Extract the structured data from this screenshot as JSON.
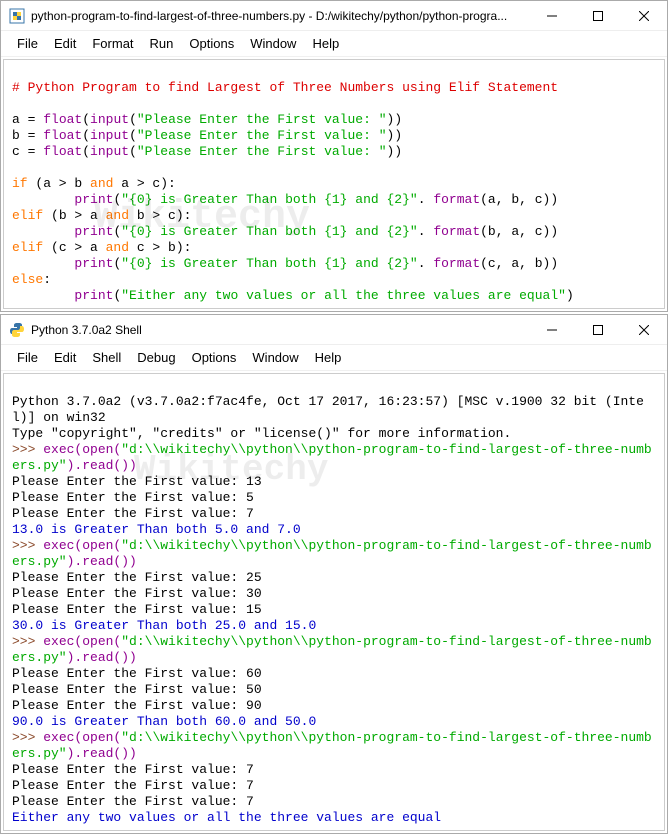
{
  "editor": {
    "title": "python-program-to-find-largest-of-three-numbers.py - D:/wikitechy/python/python-progra...",
    "menu": [
      "File",
      "Edit",
      "Format",
      "Run",
      "Options",
      "Window",
      "Help"
    ],
    "code": {
      "comment": "# Python Program to find Largest of Three Numbers using Elif Statement",
      "l1a": "a = ",
      "l1b": "float",
      "l1c": "(",
      "l1d": "input",
      "l1e": "(",
      "l1f": "\"Please Enter the First value: \"",
      "l1g": "))",
      "l2a": "b = ",
      "l2b": "float",
      "l2c": "(",
      "l2d": "input",
      "l2e": "(",
      "l2f": "\"Please Enter the First value: \"",
      "l2g": "))",
      "l3a": "c = ",
      "l3b": "float",
      "l3c": "(",
      "l3d": "input",
      "l3e": "(",
      "l3f": "\"Please Enter the First value: \"",
      "l3g": "))",
      "if1": "if ",
      "cond1": "(a > b ",
      "and1": "and",
      "cond1b": " a > c):",
      "p1a": "        ",
      "p1b": "print",
      "p1c": "(",
      "p1d": "\"{0} is Greater Than both {1} and {2}\"",
      "p1e": ". ",
      "p1f": "format",
      "p1g": "(a, b, c))",
      "elif1": "elif ",
      "cond2": "(b > a ",
      "and2": "and",
      "cond2b": " b > c):",
      "p2a": "        ",
      "p2b": "print",
      "p2c": "(",
      "p2d": "\"{0} is Greater Than both {1} and {2}\"",
      "p2e": ". ",
      "p2f": "format",
      "p2g": "(b, a, c))",
      "elif2": "elif ",
      "cond3": "(c > a ",
      "and3": "and",
      "cond3b": " c > b):",
      "p3a": "        ",
      "p3b": "print",
      "p3c": "(",
      "p3d": "\"{0} is Greater Than both {1} and {2}\"",
      "p3e": ". ",
      "p3f": "format",
      "p3g": "(c, a, b))",
      "else": "else",
      "elsec": ":",
      "p4a": "        ",
      "p4b": "print",
      "p4c": "(",
      "p4d": "\"Either any two values or all the three values are equal\"",
      "p4e": ")"
    }
  },
  "shell": {
    "title": "Python 3.7.0a2 Shell",
    "menu": [
      "File",
      "Edit",
      "Shell",
      "Debug",
      "Options",
      "Window",
      "Help"
    ],
    "banner1": "Python 3.7.0a2 (v3.7.0a2:f7ac4fe, Oct 17 2017, 16:23:57) [MSC v.1900 32 bit (Intel)] on win32",
    "banner2": "Type \"copyright\", \"credits\" or \"license()\" for more information.",
    "prompt": ">>> ",
    "exec_pre": "exec(open(",
    "exec_path": "\"d:\\\\wikitechy\\\\python\\\\python-program-to-find-largest-of-three-numbers.py\"",
    "exec_post": ").read())",
    "ask": "Please Enter the First value: ",
    "run1": {
      "v": [
        "13",
        "5",
        "7"
      ],
      "out": "13.0 is Greater Than both 5.0 and 7.0"
    },
    "run2": {
      "v": [
        "25",
        "30",
        "15"
      ],
      "out": "30.0 is Greater Than both 25.0 and 15.0"
    },
    "run3": {
      "v": [
        "60",
        "50",
        "90"
      ],
      "out": "90.0 is Greater Than both 60.0 and 50.0"
    },
    "run4": {
      "v": [
        "7",
        "7",
        "7"
      ],
      "out": "Either any two values or all the three values are equal"
    }
  },
  "watermark": "Wikitechy"
}
